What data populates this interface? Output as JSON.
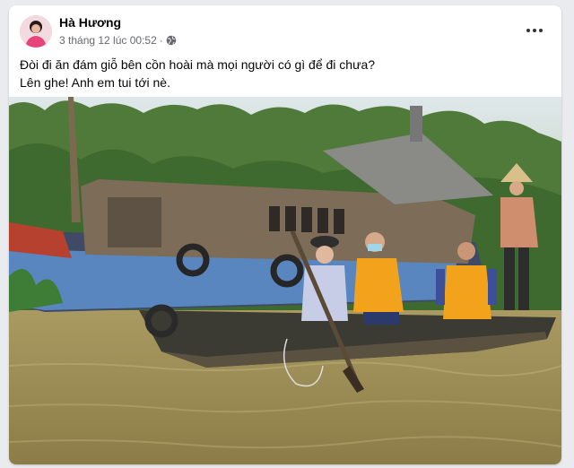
{
  "post": {
    "author": "Hà Hương",
    "timestamp": "3 tháng 12 lúc 00:52",
    "separator": "·",
    "audience_icon": "globe-icon",
    "more_icon": "more-options-icon",
    "caption_lines": [
      "Đòi đi ăn đám giỗ bên cồn hoài mà mọi người có gì để đi chưa?",
      "Lên ghe! Anh em tui tới nè."
    ],
    "photo_description_icon": "post-photo"
  },
  "colors": {
    "author_text": "#050505",
    "meta_text": "#65676b",
    "river": "#9a8a55",
    "life_vest": "#f2a21b"
  }
}
